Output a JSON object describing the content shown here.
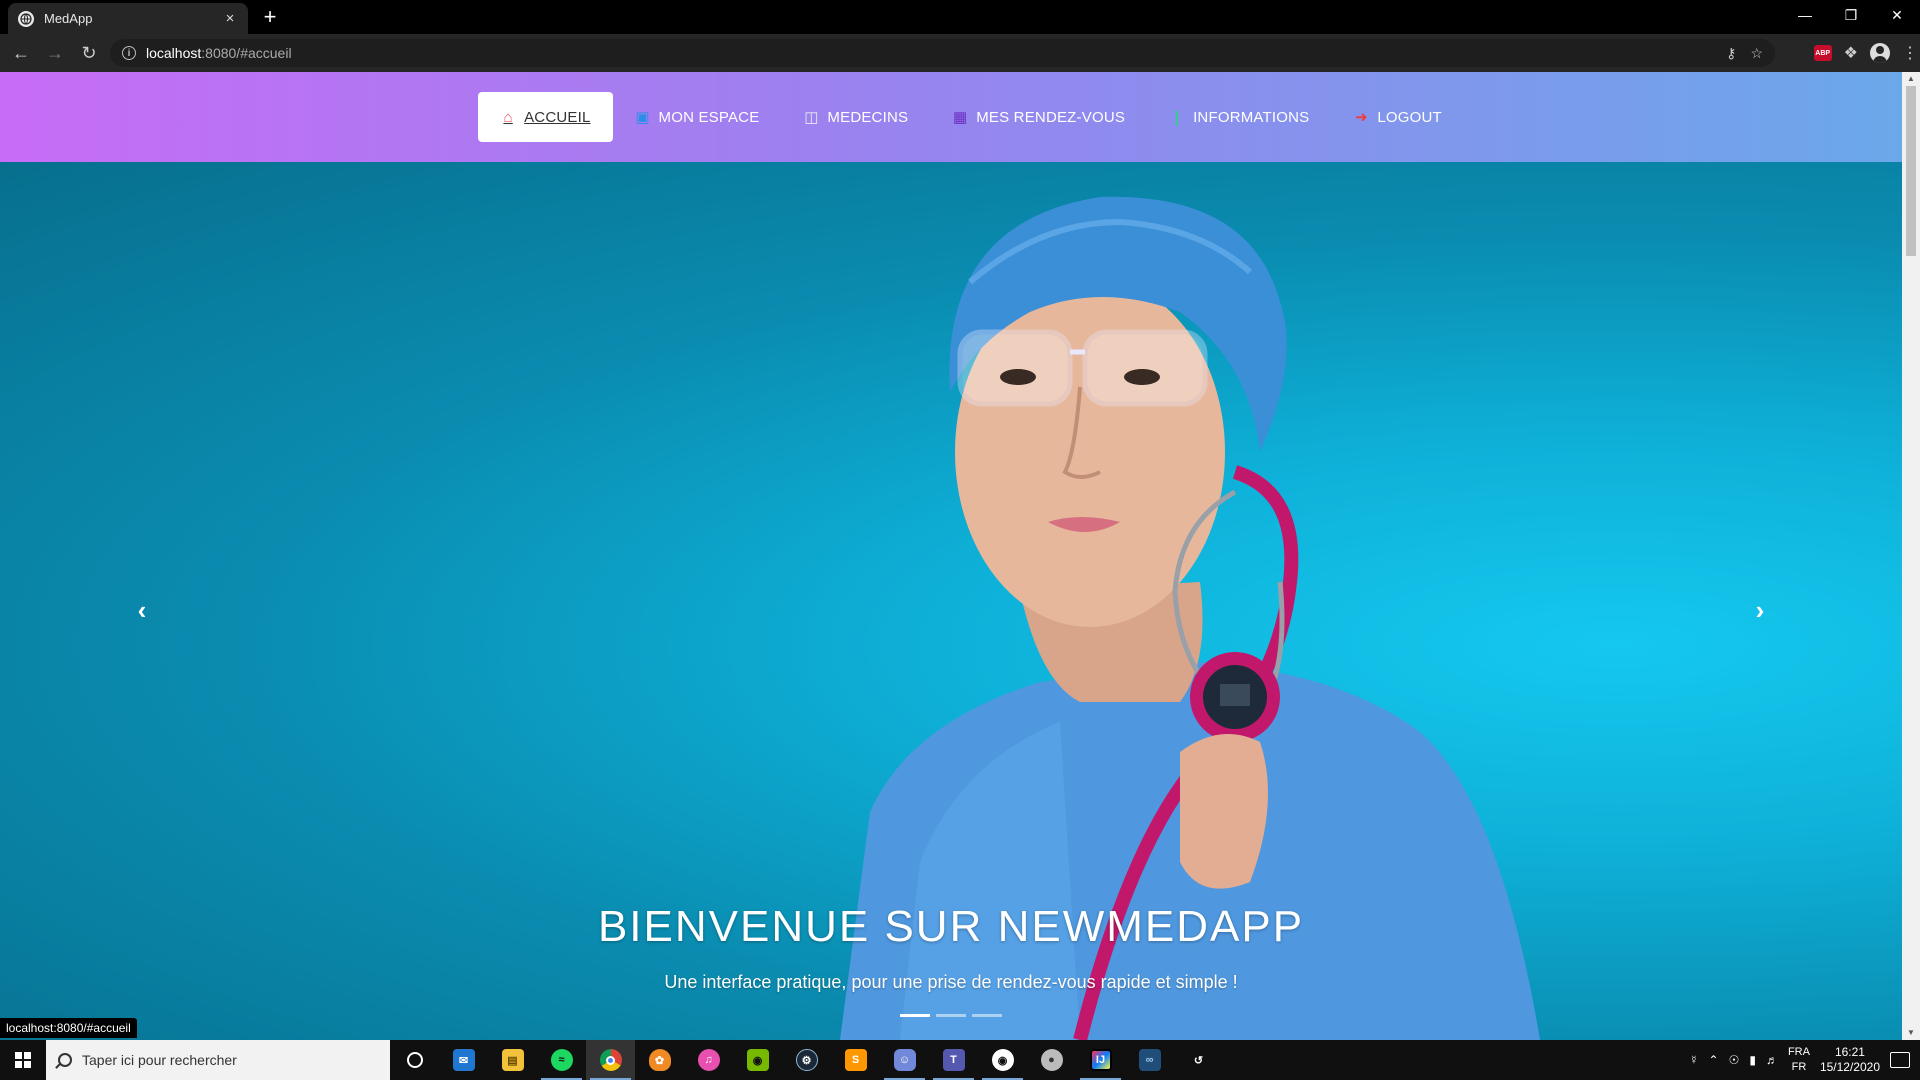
{
  "browser": {
    "tab_title": "MedApp",
    "tab_close": "×",
    "new_tab": "+",
    "url_host": "localhost",
    "url_path": ":8080/#accueil",
    "status_url": "localhost:8080/#accueil"
  },
  "navbar": {
    "items": [
      {
        "label": "ACCUEIL",
        "icon": "home-icon",
        "active": true
      },
      {
        "label": "MON ESPACE",
        "icon": "user-space-icon",
        "active": false
      },
      {
        "label": "MEDECINS",
        "icon": "hospital-icon",
        "active": false
      },
      {
        "label": "MES RENDEZ-VOUS",
        "icon": "calendar-icon",
        "active": false
      },
      {
        "label": "INFORMATIONS",
        "icon": "info-icon",
        "active": false
      },
      {
        "label": "LOGOUT",
        "icon": "logout-icon",
        "active": false
      }
    ]
  },
  "carousel": {
    "title": "BIENVENUE SUR NEWMEDAPP",
    "subtitle": "Une interface pratique, pour une prise de rendez-vous rapide et simple !",
    "prev": "‹",
    "next": "›",
    "slide_count": 3,
    "active_slide": 1
  },
  "taskbar": {
    "search_placeholder": "Taper ici pour rechercher",
    "lang_top": "FRA",
    "lang_bottom": "FR",
    "time": "16:21",
    "date": "15/12/2020",
    "apps": [
      "cortana",
      "mail",
      "file-explorer",
      "spotify",
      "chrome",
      "fl-studio",
      "itunes",
      "nvidia",
      "steam",
      "sublime-text",
      "discord",
      "teams",
      "obs",
      "app-generic",
      "intellij",
      "visual-studio",
      "app-arrow"
    ]
  },
  "colors": {
    "navbar_start": "#c76cf6",
    "navbar_end": "#6ba8ea",
    "hero_bg": "#0eb0d8"
  }
}
